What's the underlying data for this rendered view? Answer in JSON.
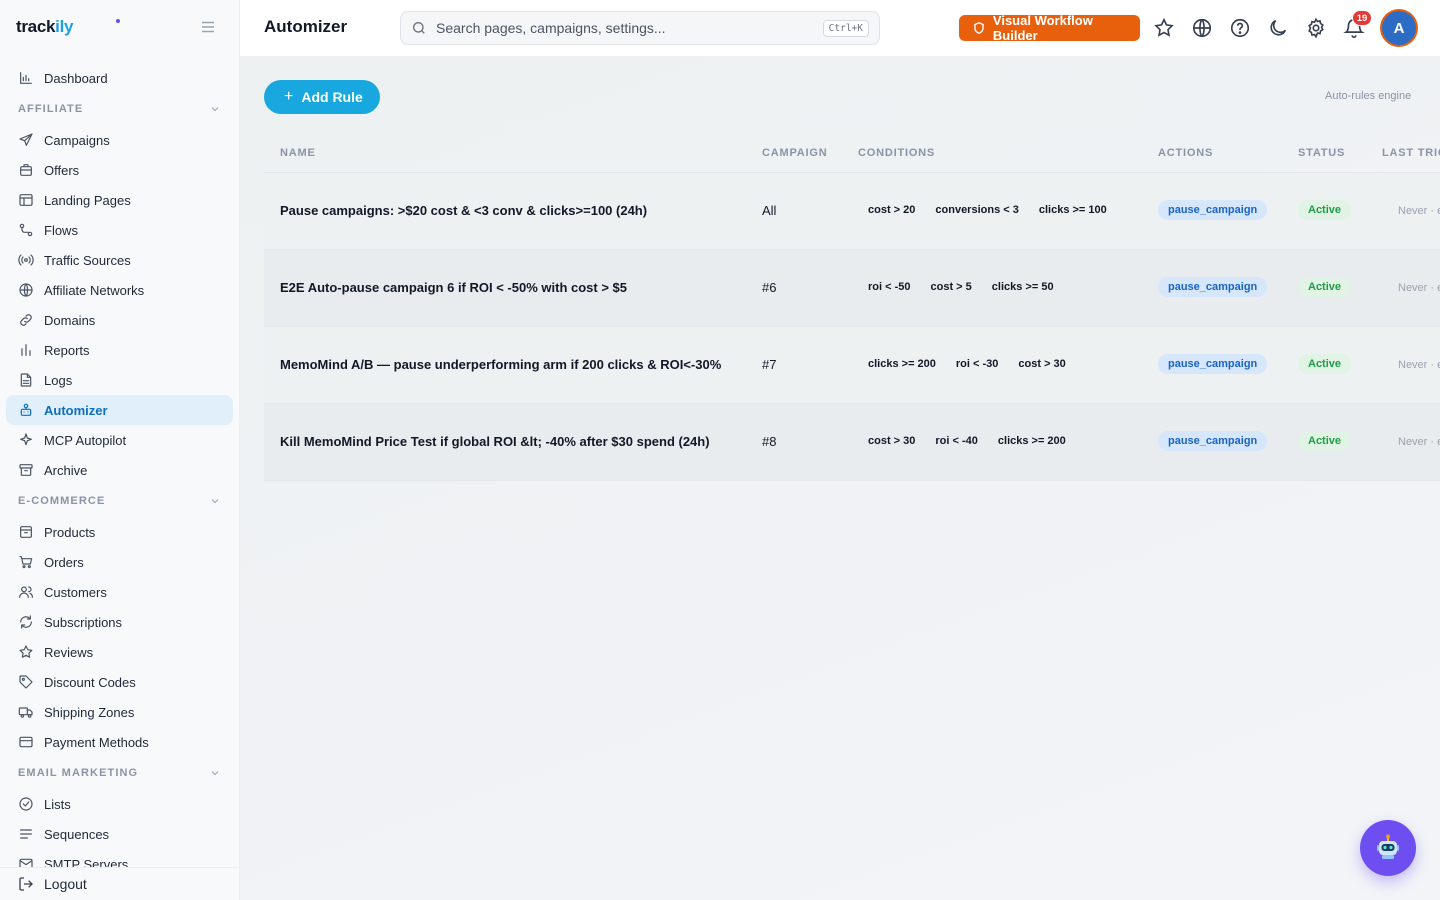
{
  "app": {
    "brand_prefix": "track",
    "brand_highlight": "ily"
  },
  "sidebar": {
    "items_top": [
      {
        "label": "Dashboard",
        "icon": "bar-chart-icon"
      }
    ],
    "sections": [
      {
        "title": "AFFILIATE",
        "items": [
          {
            "label": "Campaigns",
            "icon": "send-icon"
          },
          {
            "label": "Offers",
            "icon": "briefcase-icon"
          },
          {
            "label": "Landing Pages",
            "icon": "layout-icon"
          },
          {
            "label": "Flows",
            "icon": "flow-icon"
          },
          {
            "label": "Traffic Sources",
            "icon": "broadcast-icon"
          },
          {
            "label": "Affiliate Networks",
            "icon": "globe-icon"
          },
          {
            "label": "Domains",
            "icon": "link-icon"
          },
          {
            "label": "Reports",
            "icon": "reports-icon"
          },
          {
            "label": "Logs",
            "icon": "file-icon"
          },
          {
            "label": "Automizer",
            "icon": "robot-icon",
            "active": true
          },
          {
            "label": "MCP Autopilot",
            "icon": "sparkle-icon"
          },
          {
            "label": "Archive",
            "icon": "archive-icon"
          }
        ]
      },
      {
        "title": "E-COMMERCE",
        "items": [
          {
            "label": "Products",
            "icon": "box-icon"
          },
          {
            "label": "Orders",
            "icon": "cart-icon"
          },
          {
            "label": "Customers",
            "icon": "users-icon"
          },
          {
            "label": "Subscriptions",
            "icon": "refresh-icon"
          },
          {
            "label": "Reviews",
            "icon": "star-icon"
          },
          {
            "label": "Discount Codes",
            "icon": "tag-icon"
          },
          {
            "label": "Shipping Zones",
            "icon": "truck-icon"
          },
          {
            "label": "Payment Methods",
            "icon": "credit-card-icon"
          }
        ]
      },
      {
        "title": "EMAIL MARKETING",
        "items": [
          {
            "label": "Lists",
            "icon": "check-circle-icon"
          },
          {
            "label": "Sequences",
            "icon": "lines-icon"
          },
          {
            "label": "SMTP Servers",
            "icon": "mail-icon"
          }
        ]
      }
    ],
    "logout_label": "Logout"
  },
  "header": {
    "title": "Automizer",
    "search_placeholder": "Search pages, campaigns, settings...",
    "search_shortcut": "Ctrl+K",
    "visual_builder_label": "Visual Workflow Builder",
    "notification_count": "19",
    "avatar_initial": "A"
  },
  "main": {
    "add_rule_label": "Add Rule",
    "engine_label": "Auto-rules engine",
    "columns": [
      "NAME",
      "CAMPAIGN",
      "CONDITIONS",
      "ACTIONS",
      "STATUS",
      "LAST TRIG"
    ],
    "rows": [
      {
        "name": "Pause campaigns: >$20 cost & <3 conv & clicks>=100 (24h)",
        "campaign": "All",
        "conditions": [
          "cost > 20",
          "conversions < 3",
          "clicks >= 100"
        ],
        "action": "pause_campaign",
        "status": "Active",
        "last": "Never · eve"
      },
      {
        "name": "E2E Auto-pause campaign 6 if ROI < -50% with cost > $5",
        "campaign": "#6",
        "conditions": [
          "roi < -50",
          "cost > 5",
          "clicks >= 50"
        ],
        "action": "pause_campaign",
        "status": "Active",
        "last": "Never · eve"
      },
      {
        "name": "MemoMind A/B — pause underperforming arm if 200 clicks & ROI<-30%",
        "campaign": "#7",
        "conditions": [
          "clicks >= 200",
          "roi < -30",
          "cost > 30"
        ],
        "action": "pause_campaign",
        "status": "Active",
        "last": "Never · eve"
      },
      {
        "name": "Kill MemoMind Price Test if global ROI &lt; -40% after $30 spend (24h)",
        "campaign": "#8",
        "conditions": [
          "cost > 30",
          "roi < -40",
          "clicks >= 200"
        ],
        "action": "pause_campaign",
        "status": "Active",
        "last": "Never · eve"
      }
    ]
  },
  "colors": {
    "accent": "#18a8df",
    "brand_orange": "#e8600c",
    "active_nav_bg": "#e1effb",
    "fab": "#6e4ef0"
  }
}
